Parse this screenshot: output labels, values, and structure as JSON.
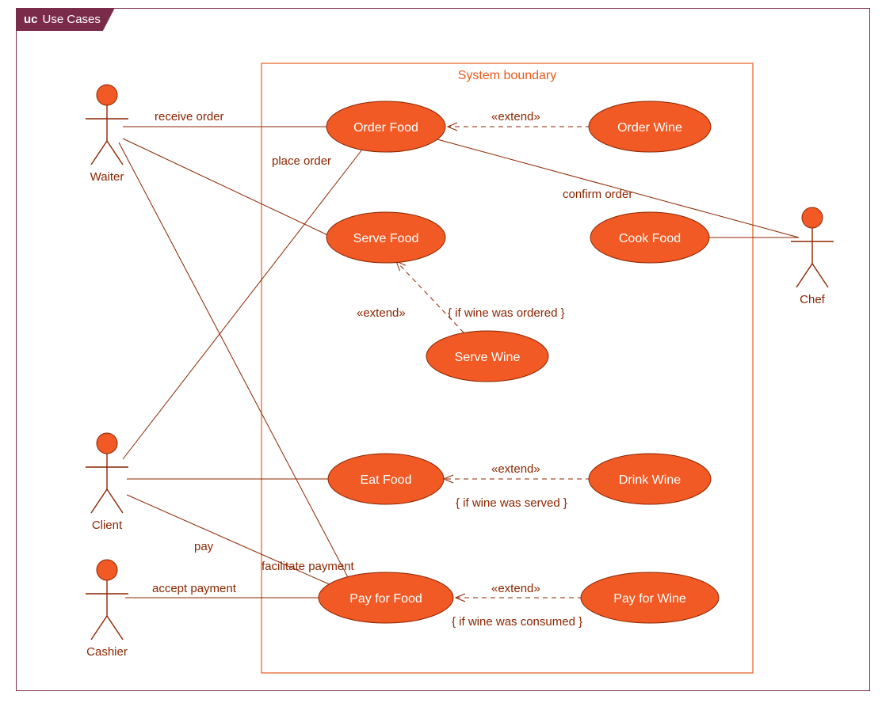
{
  "tab": {
    "prefix": "uc",
    "label": "Use Cases"
  },
  "boundary": {
    "label": "System boundary"
  },
  "actors": {
    "waiter": "Waiter",
    "client": "Client",
    "cashier": "Cashier",
    "chef": "Chef"
  },
  "usecases": {
    "orderFood": "Order Food",
    "orderWine": "Order Wine",
    "serveFood": "Serve Food",
    "cookFood": "Cook Food",
    "serveWine": "Serve Wine",
    "eatFood": "Eat Food",
    "drinkWine": "Drink Wine",
    "payFood": "Pay for Food",
    "payWine": "Pay for Wine"
  },
  "edges": {
    "receiveOrder": "receive order",
    "placeOrder": "place order",
    "confirmOrder": "confirm order",
    "pay": "pay",
    "facilitatePayment": "facilitate payment",
    "acceptPayment": "accept payment",
    "extend": "«extend»"
  },
  "guards": {
    "wineOrdered": "{ if wine was ordered }",
    "wineServed": "{ if wine was served }",
    "wineConsumed": "{ if wine was consumed }"
  },
  "colors": {
    "orange": "#f15a24",
    "brown": "#8b2500",
    "boundary": "#e85a1a",
    "frame": "#7a2b4a"
  }
}
